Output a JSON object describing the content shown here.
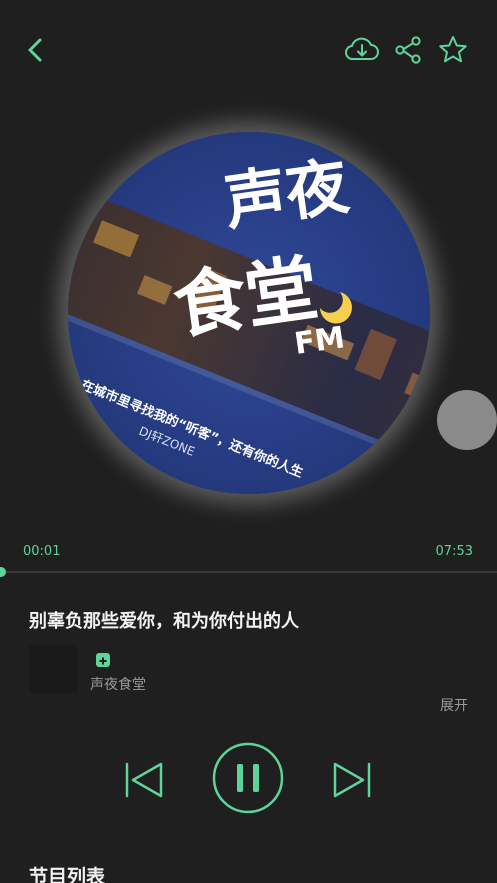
{
  "colors": {
    "accent": "#5fd39a",
    "background": "#1f1f1f",
    "disc_blue": "#2a3f85"
  },
  "toolbar": {
    "back_icon": "chevron-left-icon",
    "download_icon": "cloud-download-icon",
    "share_icon": "share-icon",
    "favorite_icon": "star-icon"
  },
  "cover": {
    "title_line1": "声夜",
    "title_line2": "食堂",
    "fm_tag": "FM",
    "slogan": "在城市里寻找我的“听客”，还有你的人生",
    "dj_credit": "DJ轩ZONE"
  },
  "player": {
    "current_time": "00:01",
    "total_time": "07:53",
    "progress": 0.002
  },
  "track": {
    "title": "别辜负那些爱你，和为你付出的人",
    "author": "声夜食堂",
    "expand_label": "展开"
  },
  "controls": {
    "prev_icon": "skip-previous-icon",
    "pause_icon": "pause-icon",
    "next_icon": "skip-next-icon"
  },
  "section": {
    "program_list": "节目列表"
  }
}
